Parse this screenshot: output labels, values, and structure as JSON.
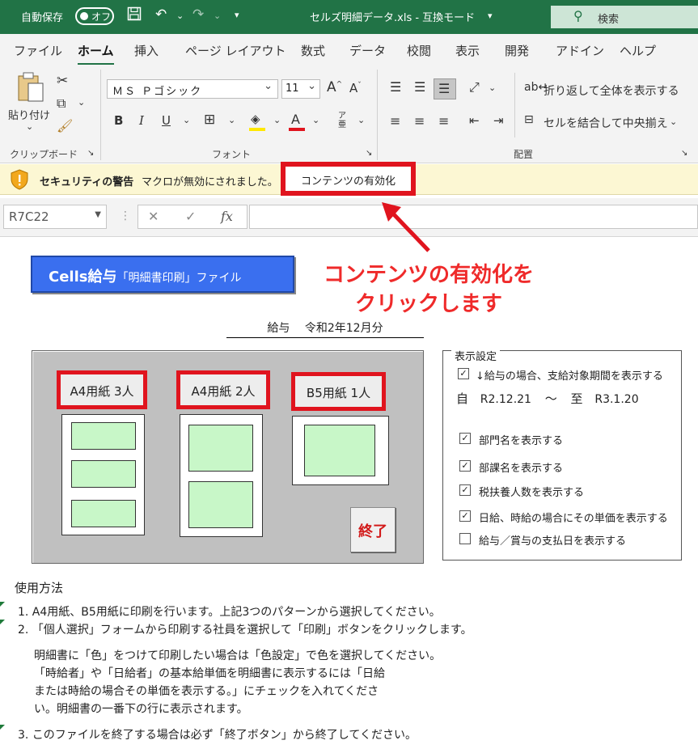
{
  "titlebar": {
    "autosave_label": "自動保存",
    "autosave_state": "オフ",
    "filename": "セルズ明細データ.xls  -  互換モード",
    "search_placeholder": "検索",
    "bg_color": "#217346"
  },
  "tabs": [
    "ファイル",
    "ホーム",
    "挿入",
    "ページ レイアウト",
    "数式",
    "データ",
    "校閲",
    "表示",
    "開発",
    "アドイン",
    "ヘルプ"
  ],
  "active_tab": "ホーム",
  "ribbon": {
    "paste_label": "貼り付け",
    "clipboard_group": "クリップボード",
    "font_name": "ＭＳ Ｐゴシック",
    "font_size": "11",
    "font_group": "フォント",
    "bold": "B",
    "italic": "I",
    "underline": "U",
    "wrap_text": "折り返して全体を表示する",
    "merge_center": "セルを結合して中央揃え",
    "align_group": "配置"
  },
  "security": {
    "title": "セキュリティの警告",
    "message": "マクロが無効にされました。",
    "enable_button": "コンテンツの有効化"
  },
  "formula_bar": {
    "name_box": "R7C22",
    "fx": "fx",
    "formula": ""
  },
  "sheet": {
    "app_button_main": "Cells給与",
    "app_button_sub": "「明細書印刷」ファイル",
    "annotation_line1": "コンテンツの有効化を",
    "annotation_line2": "クリックします",
    "period_label": "給与　 令和2年12月分",
    "print_buttons": [
      "A4用紙 3人",
      "A4用紙 2人",
      "B5用紙 1人"
    ],
    "end_button": "終了",
    "settings": {
      "legend": "表示設定",
      "period_option": "↓給与の場合、支給対象期間を表示する",
      "period_from_label": "自",
      "period_from": "R2.12.21",
      "tilde": "〜",
      "period_to_label": "至",
      "period_to": "R3.1.20",
      "options": [
        {
          "label": "部門名を表示する",
          "checked": true
        },
        {
          "label": "部課名を表示する",
          "checked": true
        },
        {
          "label": "税扶養人数を表示する",
          "checked": true
        },
        {
          "label": "日給、時給の場合にその単価を表示する",
          "checked": true
        },
        {
          "label": "給与／賞与の支払日を表示する",
          "checked": false
        }
      ],
      "check_mark": "✓"
    },
    "usage_title": "使用方法",
    "usage_lines": [
      "1. A4用紙、B5用紙に印刷を行います。上記3つのパターンから選択してください。",
      "2. 「個人選択」フォームから印刷する社員を選択して「印刷」ボタンをクリックします。",
      "明細書に「色」をつけて印刷したい場合は「色設定」で色を選択してください。",
      "「時給者」や「日給者」の基本給単価を明細書に表示するには「日給",
      "または時給の場合その単価を表示する。」にチェックを入れてくださ",
      "い。明細書の一番下の行に表示されます。",
      "3. このファイルを終了する場合は必ず「終了ボタン」から終了してください。"
    ]
  }
}
